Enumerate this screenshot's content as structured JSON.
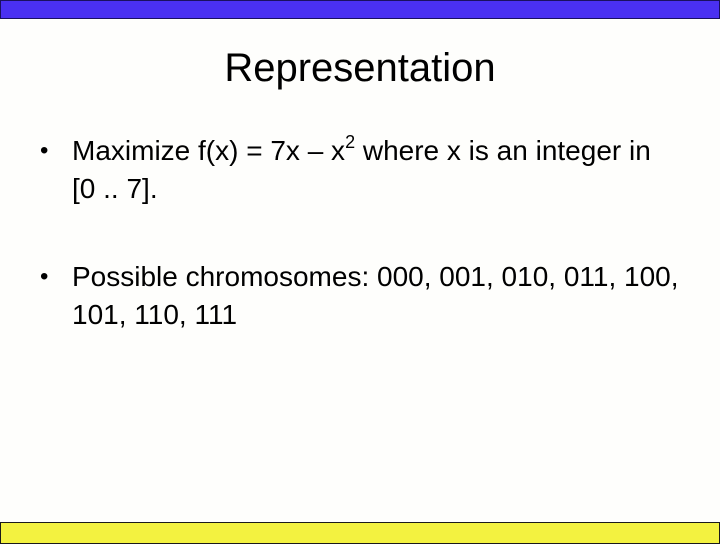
{
  "slide": {
    "title": "Representation",
    "bullets": [
      {
        "marker": "•",
        "text_before": "Maximize f(x) = 7x – x",
        "superscript": "2",
        "text_after": " where x is an integer in [0 .. 7]."
      },
      {
        "marker": "•",
        "text": "Possible chromosomes: 000, 001, 010, 011, 100, 101, 110, 111"
      }
    ]
  },
  "theme": {
    "top_bar_color": "#4a30f2",
    "bottom_bar_color": "#f3f240",
    "background": "#fefefc"
  }
}
